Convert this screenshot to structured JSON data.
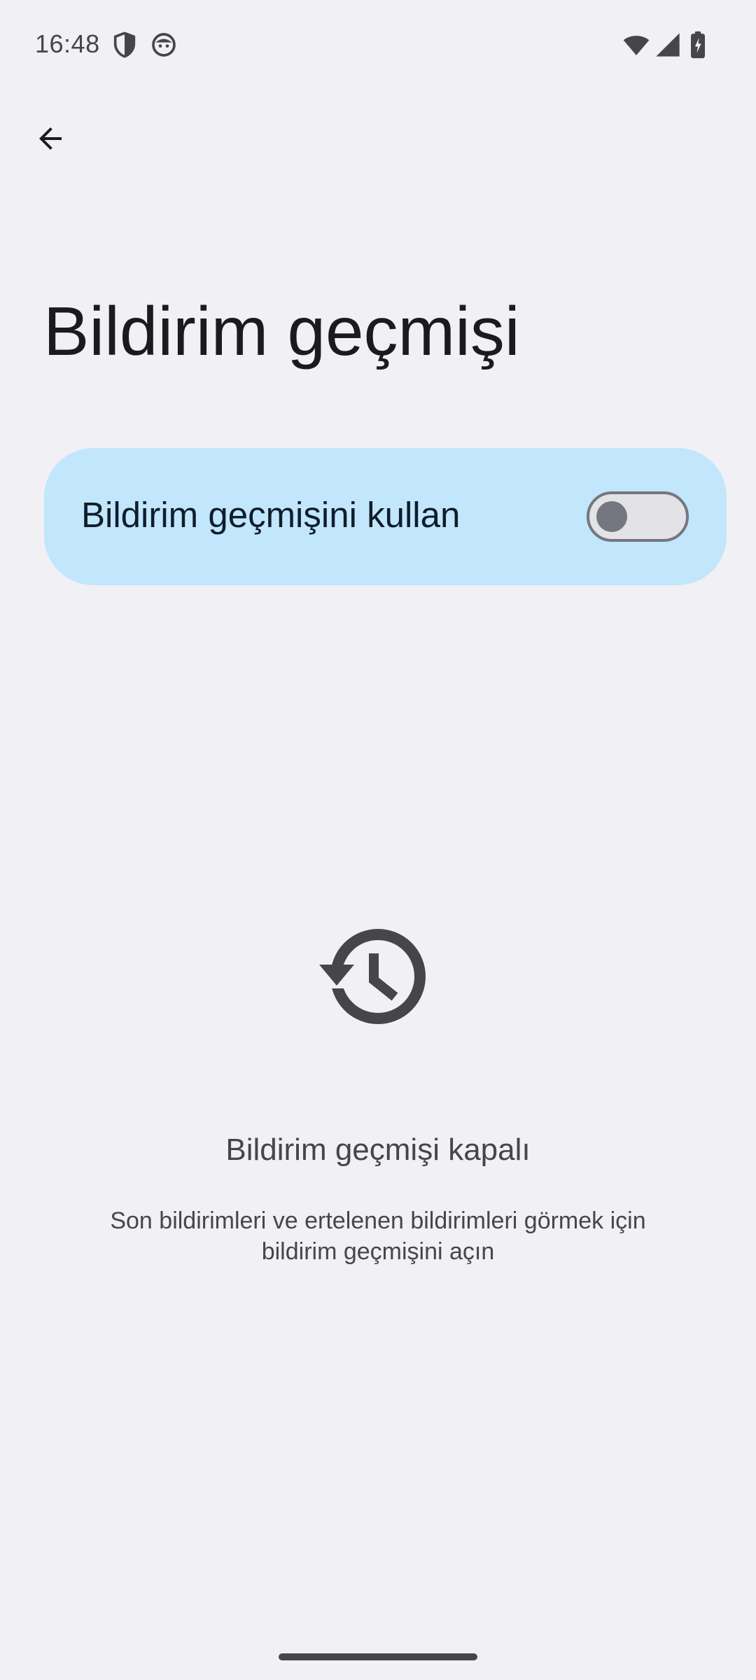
{
  "status_bar": {
    "time": "16:48",
    "left_icons": [
      "shield-icon",
      "android-face-icon"
    ],
    "right_icons": [
      "wifi-icon",
      "cellular-signal-icon",
      "battery-charging-icon"
    ]
  },
  "app_bar": {
    "back_icon": "arrow-back-icon"
  },
  "page": {
    "title": "Bildirim geçmişi"
  },
  "toggle_card": {
    "label": "Bildirim geçmişini kullan",
    "checked": false,
    "background": "#c2e6fc"
  },
  "empty_state": {
    "icon": "history-icon",
    "title": "Bildirim geçmişi kapalı",
    "description": "Son bildirimleri ve ertelenen bildirimleri görmek için bildirim geçmişini açın"
  },
  "colors": {
    "background": "#f1f0f4",
    "accent_card": "#c2e6fc",
    "icon_gray": "#46464a",
    "switch_outline": "#74777f"
  }
}
